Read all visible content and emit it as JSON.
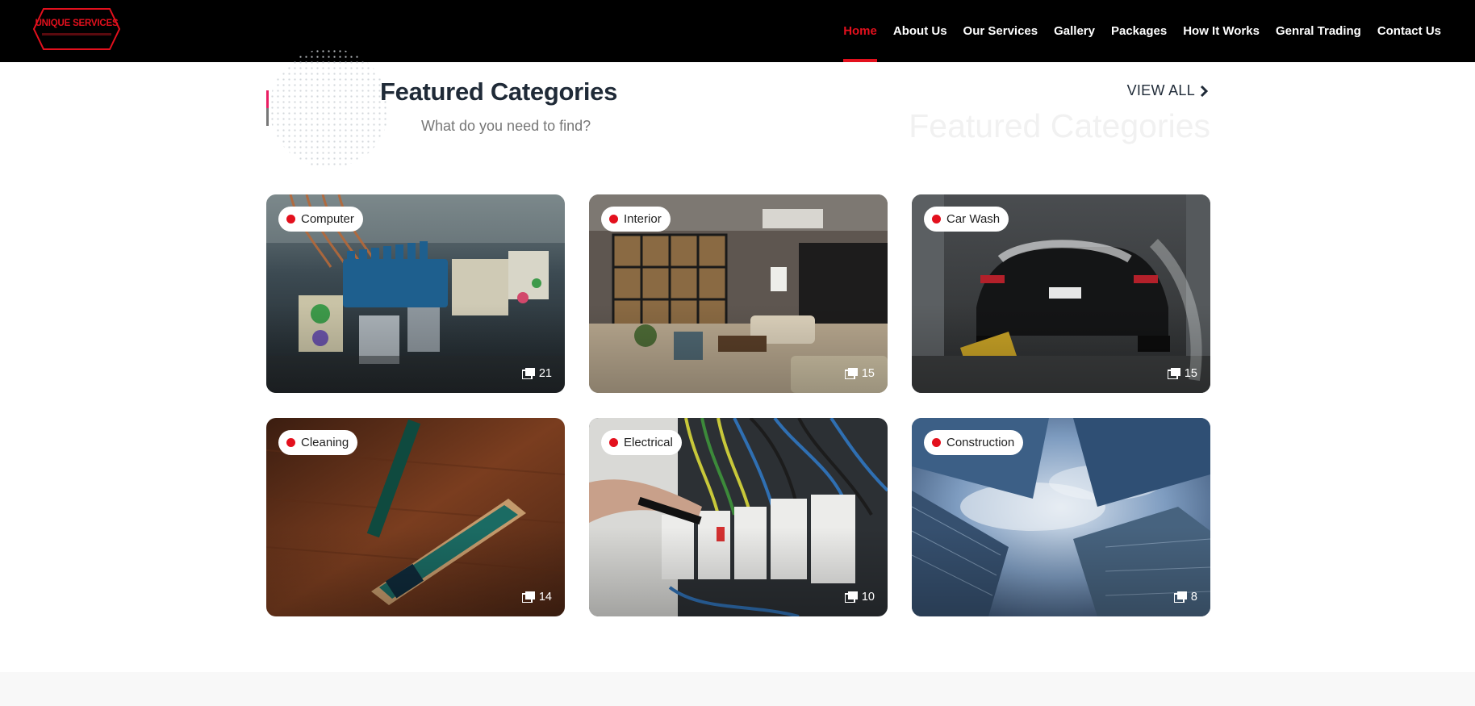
{
  "brand": {
    "name": "UNIQUE SERVICES",
    "accent": "#e3101d"
  },
  "nav": {
    "items": [
      {
        "label": "Home",
        "active": true
      },
      {
        "label": "About Us"
      },
      {
        "label": "Our Services"
      },
      {
        "label": "Gallery"
      },
      {
        "label": "Packages"
      },
      {
        "label": "How It Works"
      },
      {
        "label": "Genral Trading"
      },
      {
        "label": "Contact Us"
      }
    ]
  },
  "section": {
    "title": "Featured Categories",
    "subtitle": "What do you need to find?",
    "ghost_title": "Featured Categories",
    "view_all": "VIEW ALL"
  },
  "categories": [
    {
      "name": "Computer",
      "count": "21",
      "image": "motherboard-photo"
    },
    {
      "name": "Interior",
      "count": "15",
      "image": "lounge-interior-photo"
    },
    {
      "name": "Car Wash",
      "count": "15",
      "image": "car-wash-photo"
    },
    {
      "name": "Cleaning",
      "count": "14",
      "image": "mop-on-wood-floor-photo"
    },
    {
      "name": "Electrical",
      "count": "10",
      "image": "electrical-panel-photo"
    },
    {
      "name": "Construction",
      "count": "8",
      "image": "skyscrapers-photo"
    }
  ],
  "icons": {
    "count_icon": "images-stack-icon",
    "view_all_icon": "chevron-right-icon"
  }
}
